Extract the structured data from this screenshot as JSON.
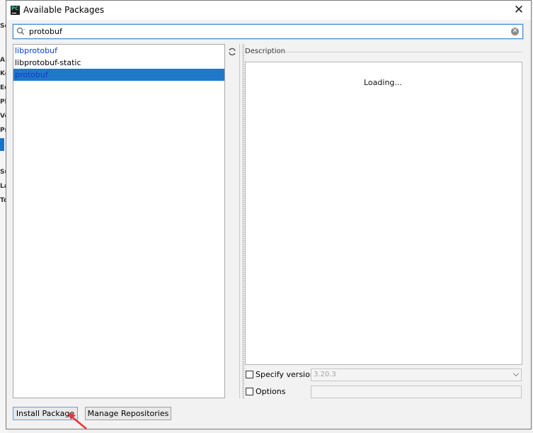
{
  "window": {
    "title": "Available Packages"
  },
  "search": {
    "value": "protobuf"
  },
  "packages": [
    {
      "name": "libprotobuf",
      "style": "link"
    },
    {
      "name": "libprotobuf-static",
      "style": "plain"
    },
    {
      "name": "protobuf",
      "style": "selected"
    }
  ],
  "description": {
    "label": "Description",
    "status": "Loading..."
  },
  "specify_version": {
    "label": "Specify version",
    "checked": false,
    "value": "3.20.3"
  },
  "options": {
    "label": "Options",
    "checked": false,
    "value": ""
  },
  "buttons": {
    "install": "Install Package",
    "manage": "Manage Repositories"
  },
  "colors": {
    "selection": "#1f78c8",
    "link": "#0d3bd6",
    "focus_border": "#4a8fd4",
    "annotation_arrow": "#e53935"
  },
  "background_fragments": [
    "Se",
    "A",
    "Ke",
    "Ed",
    "Pl",
    "Ve",
    "Pr",
    "Su",
    "La",
    "To"
  ]
}
